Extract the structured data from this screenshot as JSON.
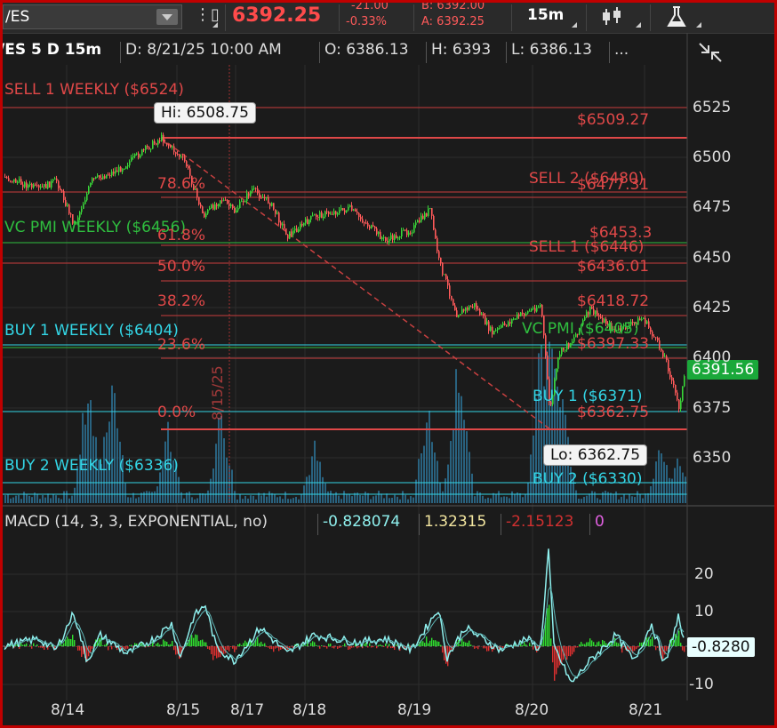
{
  "toolbar": {
    "symbol": "/ES",
    "last_price": "6392.25",
    "net_change": "-21.00",
    "pct_change": "-0.33%",
    "bid": "B: 6392.00",
    "ask": "A: 6392.25",
    "timeframe": "15m"
  },
  "infobar": {
    "title": "/ES 5 D 15m",
    "date": "D: 8/21/25 10:00 AM",
    "open": "O: 6386.13",
    "high": "H: 6393",
    "low": "L: 6386.13",
    "more": "..."
  },
  "levels": {
    "sell1_weekly": "SELL 1 WEEKLY ($6524)",
    "vc_pmi_weekly": "VC PMI WEEKLY ($6456)",
    "buy1_weekly": "BUY 1 WEEKLY ($6404)",
    "buy2_weekly": "BUY 2 WEEKLY ($6336)",
    "sell2": "SELL 2 ($6480)",
    "sell1": "SELL 1 ($6446)",
    "vc_pmi": "VC PMI ($6405)",
    "buy1": "BUY 1 ($6371)",
    "buy2": "BUY 2 ($6330)",
    "fib_786": "78.6%",
    "fib_618": "61.8%",
    "fib_500": "50.0%",
    "fib_382": "38.2%",
    "fib_236": "23.6%",
    "fib_0": "0.0%",
    "price_6509": "$6509.27",
    "price_6477": "$6477.31",
    "price_6453": "$6453.3",
    "price_6436": "$6436.01",
    "price_6418": "$6418.72",
    "price_6397": "$6397.33",
    "price_6362": "$6362.75",
    "vertical_label": "8/15/25"
  },
  "annotations": {
    "hi": "Hi: 6508.75",
    "lo": "Lo: 6362.75",
    "current": "6391.56",
    "macd_current": "-0.8280"
  },
  "price_axis": [
    "6525",
    "6500",
    "6475",
    "6450",
    "6425",
    "6400",
    "6375",
    "6350"
  ],
  "macd": {
    "study": "MACD (14, 3, 3, EXPONENTIAL, no)",
    "value": "-0.828074",
    "avg": "1.32315",
    "diff": "-2.15123",
    "zero": "0",
    "axis": [
      "20",
      "10",
      "0",
      "-10"
    ]
  },
  "dates": [
    "8/14",
    "8/15",
    "8/17",
    "8/18",
    "8/19",
    "8/20",
    "8/21"
  ],
  "colors": {
    "sell": "#e04848",
    "vc_pmi": "#2fbf3f",
    "buy": "#33d6e6",
    "up_candle": "#39d639",
    "down_candle": "#ff5a5a",
    "macd_line": "#8ff0ee",
    "volume": "#2b6f90"
  }
}
